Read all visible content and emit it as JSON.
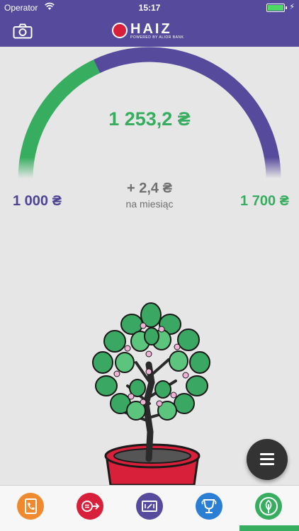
{
  "status_bar": {
    "carrier": "Operator",
    "time": "15:17"
  },
  "header": {
    "logo_text": "HAIZ",
    "logo_sub": "POWERED BY ALIOR BANK"
  },
  "gauge": {
    "current_value": "1 253,2",
    "delta": "+ 2,4",
    "delta_caption": "na miesiąc",
    "min_value": "1 000",
    "max_value": "1 700",
    "currency_symbol": "₴",
    "progress_fraction": 0.36,
    "colors": {
      "progress": "#36ad5f",
      "track": "#564a9c"
    }
  },
  "tabs": [
    {
      "name": "contacts",
      "icon": "contact-book-icon",
      "color": "#ef8a2e"
    },
    {
      "name": "transfer",
      "icon": "currency-transfer-icon",
      "color": "#d8203a"
    },
    {
      "name": "vouchers",
      "icon": "ticket-icon",
      "color": "#564a9c"
    },
    {
      "name": "rewards",
      "icon": "trophy-icon",
      "color": "#2a7fd4"
    },
    {
      "name": "savings-tree",
      "icon": "tree-icon",
      "color": "#36ad5f",
      "active": true
    }
  ],
  "colors": {
    "brand_purple": "#564a9c",
    "accent_green": "#36ad5f",
    "background": "#e6e6e6"
  }
}
